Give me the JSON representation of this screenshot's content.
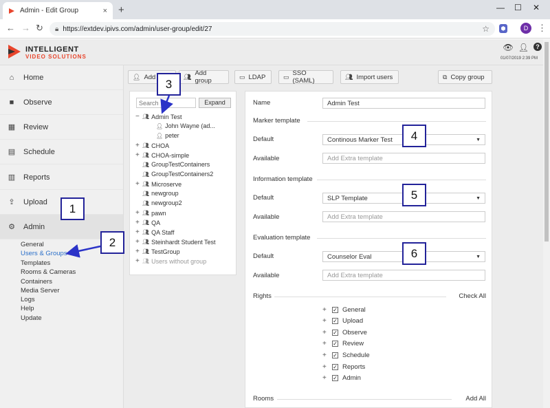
{
  "browser": {
    "tab_title": "Admin - Edit Group",
    "tab_close": "×",
    "new_tab": "+",
    "url": "https://extdev.ipivs.com/admin/user-group/edit/27",
    "profile_initial": "D"
  },
  "header": {
    "logo_line1": "INTELLIGENT",
    "logo_line2": "VIDEO SOLUTIONS",
    "datetime": "01/07/2019 2:39 PM"
  },
  "sidebar": {
    "items": [
      {
        "label": "Home",
        "icon": "home-icon"
      },
      {
        "label": "Observe",
        "icon": "video-camera-icon"
      },
      {
        "label": "Review",
        "icon": "film-icon"
      },
      {
        "label": "Schedule",
        "icon": "calendar-icon"
      },
      {
        "label": "Reports",
        "icon": "bar-chart-icon"
      },
      {
        "label": "Upload",
        "icon": "upload-icon"
      },
      {
        "label": "Admin",
        "icon": "gear-icon"
      }
    ],
    "admin_sub": [
      "General",
      "Users & Groups",
      "Templates",
      "Rooms & Cameras",
      "Containers",
      "Media Server",
      "Logs",
      "Help",
      "Update"
    ]
  },
  "toolbar": {
    "add_user": "Add u",
    "add_group": "Add group",
    "ldap": "LDAP",
    "sso": "SSO (SAML)",
    "import_users": "Import users",
    "copy_group": "Copy group"
  },
  "tree": {
    "search_placeholder": "Search",
    "expand_label": "Expand",
    "rows": [
      {
        "toggle": "−",
        "label": "Admin Test",
        "kind": "group"
      },
      {
        "toggle": "",
        "label": "John Wayne (ad...",
        "kind": "user"
      },
      {
        "toggle": "",
        "label": "peter",
        "kind": "user"
      },
      {
        "toggle": "+",
        "label": "CHOA",
        "kind": "group"
      },
      {
        "toggle": "+",
        "label": "CHOA-simple",
        "kind": "group"
      },
      {
        "toggle": "",
        "label": "GroupTestContainers",
        "kind": "group"
      },
      {
        "toggle": "",
        "label": "GroupTestContainers2",
        "kind": "group"
      },
      {
        "toggle": "+",
        "label": "Microserve",
        "kind": "group"
      },
      {
        "toggle": "",
        "label": "newgroup",
        "kind": "group"
      },
      {
        "toggle": "",
        "label": "newgroup2",
        "kind": "group"
      },
      {
        "toggle": "+",
        "label": "pawn",
        "kind": "group"
      },
      {
        "toggle": "+",
        "label": "QA",
        "kind": "group"
      },
      {
        "toggle": "+",
        "label": "QA Staff",
        "kind": "group"
      },
      {
        "toggle": "+",
        "label": "Steinhardt Student Test",
        "kind": "group"
      },
      {
        "toggle": "+",
        "label": "TestGroup",
        "kind": "group"
      },
      {
        "toggle": "+",
        "label": "Users without group",
        "kind": "group-muted"
      }
    ]
  },
  "form": {
    "name_label": "Name",
    "name_value": "Admin Test",
    "marker_section": "Marker template",
    "info_section": "Information template",
    "eval_section": "Evaluation template",
    "default_label": "Default",
    "available_label": "Available",
    "marker_default": "Continous Marker Test",
    "info_default": "SLP Template",
    "eval_default": "Counselor Eval",
    "extra_placeholder": "Add Extra template",
    "rights_label": "Rights",
    "check_all": "Check All",
    "rights": [
      "General",
      "Upload",
      "Observe",
      "Review",
      "Schedule",
      "Reports",
      "Admin"
    ],
    "rooms_label": "Rooms",
    "add_all": "Add All"
  },
  "annotations": [
    "1",
    "2",
    "3",
    "4",
    "5",
    "6"
  ],
  "colors": {
    "accent": "#2a6fc9",
    "annotation_border": "#222299",
    "logo_orange": "#e8452c"
  }
}
